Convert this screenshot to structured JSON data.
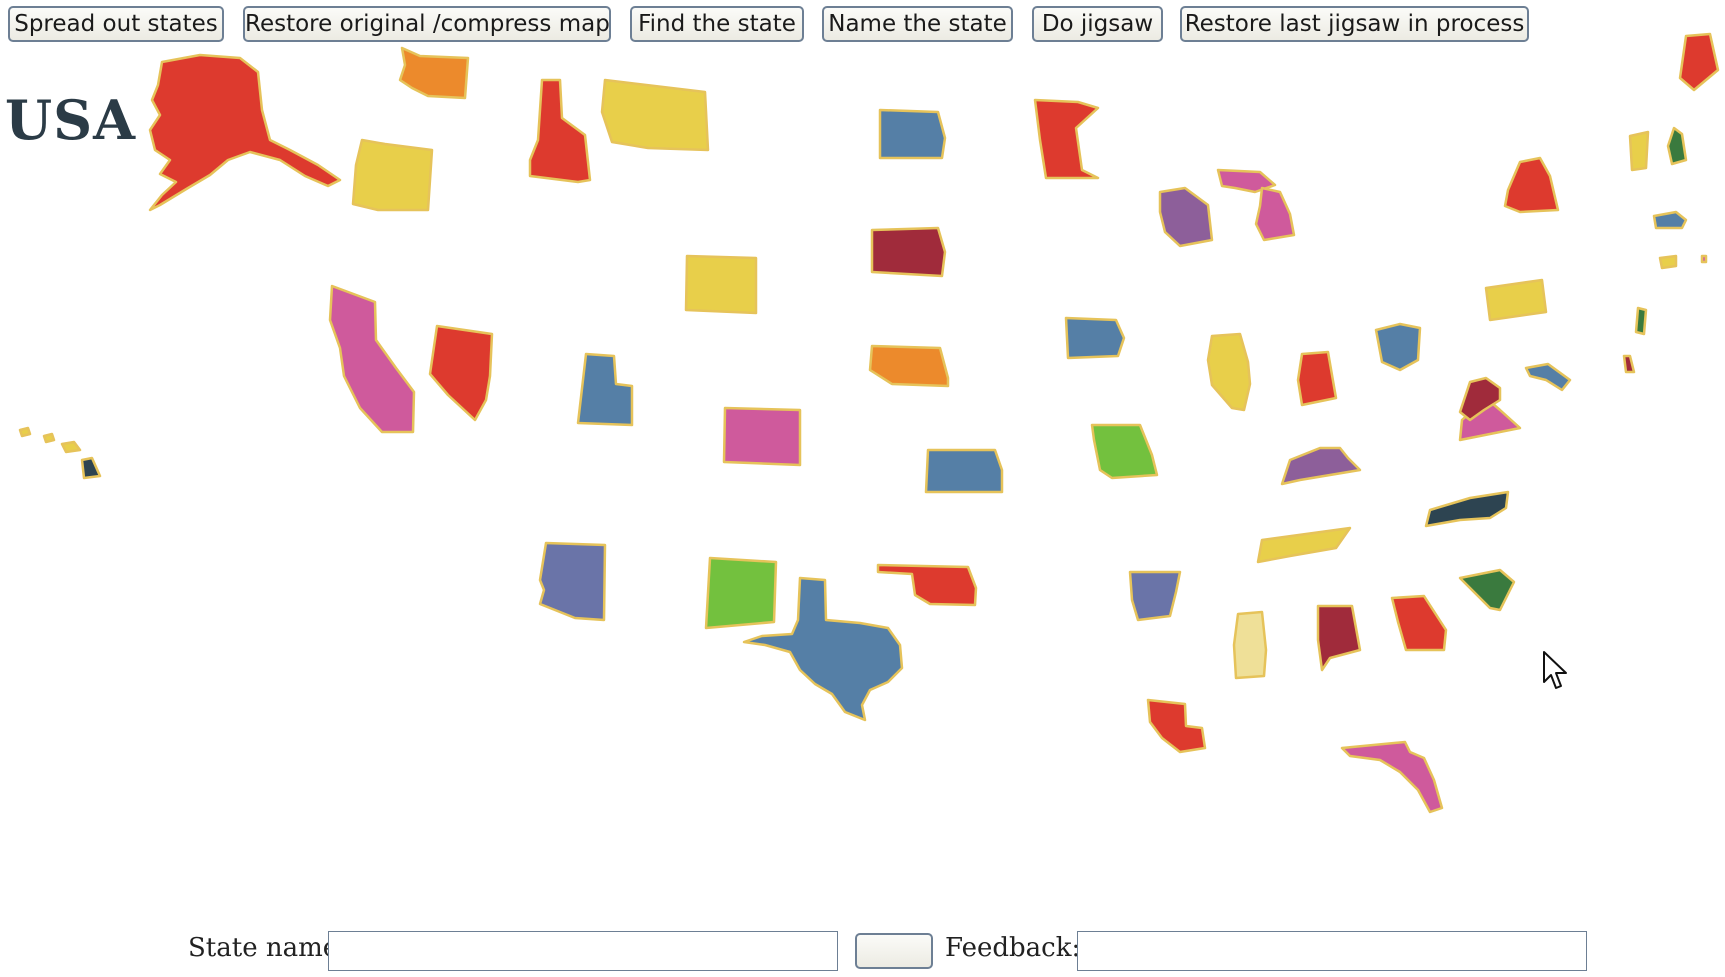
{
  "toolbar": {
    "buttons": [
      {
        "label": "Spread out states"
      },
      {
        "label": "Restore original /compress map"
      },
      {
        "label": "Find the state"
      },
      {
        "label": "Name the state"
      },
      {
        "label": "Do jigsaw"
      },
      {
        "label": "Restore last jigsaw in process"
      }
    ]
  },
  "title": "USA",
  "form": {
    "state_name_label": "State name:",
    "state_name_value": "",
    "submit_label": "",
    "feedback_label": "Feedback:",
    "feedback_value": ""
  },
  "palette": {
    "red": "#dd3a2e",
    "yellow": "#e8cf4a",
    "blue": "#557fa6",
    "pink": "#cf5a9c",
    "purple": "#8d5f9a",
    "maroon": "#a02b3b",
    "green": "#73c13e",
    "dark_green": "#3a7a3e",
    "orange": "#ec8a2c",
    "dark_slate": "#2d4451",
    "indigo": "#6a74a8",
    "pale_yellow": "#efe098",
    "outline": "#e6c35a"
  },
  "map": {
    "cursor_icon": "arrow-pointer-icon"
  }
}
